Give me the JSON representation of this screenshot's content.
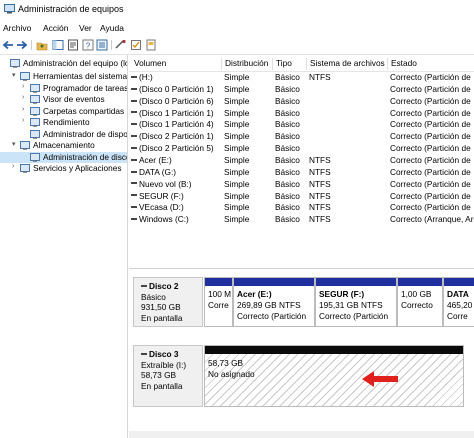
{
  "window": {
    "title": "Administración de equipos"
  },
  "menu": [
    "Archivo",
    "Acción",
    "Ver",
    "Ayuda"
  ],
  "tree": [
    {
      "label": "Administración del equipo (loc",
      "indent": 0,
      "arrow": "",
      "icon": "computer-icon"
    },
    {
      "label": "Herramientas del sistema",
      "indent": 1,
      "arrow": "▾",
      "icon": "tools-icon"
    },
    {
      "label": "Programador de tareas",
      "indent": 2,
      "arrow": "›",
      "icon": "clock-icon"
    },
    {
      "label": "Visor de eventos",
      "indent": 2,
      "arrow": "›",
      "icon": "event-viewer-icon"
    },
    {
      "label": "Carpetas compartidas",
      "indent": 2,
      "arrow": "›",
      "icon": "shared-folder-icon"
    },
    {
      "label": "Rendimiento",
      "indent": 2,
      "arrow": "›",
      "icon": "performance-icon"
    },
    {
      "label": "Administrador de dispo",
      "indent": 2,
      "arrow": "",
      "icon": "device-manager-icon"
    },
    {
      "label": "Almacenamiento",
      "indent": 1,
      "arrow": "▾",
      "icon": "storage-icon"
    },
    {
      "label": "Administración de disco",
      "indent": 2,
      "arrow": "",
      "icon": "disk-icon",
      "selected": true
    },
    {
      "label": "Servicios y Aplicaciones",
      "indent": 1,
      "arrow": "›",
      "icon": "services-icon"
    }
  ],
  "volumes": {
    "columns": [
      "Volumen",
      "Distribución",
      "Tipo",
      "Sistema de archivos",
      "Estado"
    ],
    "rows": [
      [
        "(H:)",
        "Simple",
        "Básico",
        "NTFS",
        "Correcto (Partición de"
      ],
      [
        "(Disco 0 Partición 1)",
        "Simple",
        "Básico",
        "",
        "Correcto (Partición de"
      ],
      [
        "(Disco 0 Partición 6)",
        "Simple",
        "Básico",
        "",
        "Correcto (Partición de"
      ],
      [
        "(Disco 1 Partición 1)",
        "Simple",
        "Básico",
        "",
        "Correcto (Partición de"
      ],
      [
        "(Disco 1 Partición 4)",
        "Simple",
        "Básico",
        "",
        "Correcto (Partición de"
      ],
      [
        "(Disco 2 Partición 1)",
        "Simple",
        "Básico",
        "",
        "Correcto (Partición de"
      ],
      [
        "(Disco 2 Partición 5)",
        "Simple",
        "Básico",
        "",
        "Correcto (Partición de"
      ],
      [
        "Acer (E:)",
        "Simple",
        "Básico",
        "NTFS",
        "Correcto (Partición de"
      ],
      [
        "DATA (G:)",
        "Simple",
        "Básico",
        "NTFS",
        "Correcto (Partición de"
      ],
      [
        "Nuevo vol (B:)",
        "Simple",
        "Básico",
        "NTFS",
        "Correcto (Partición de"
      ],
      [
        "SEGUR (F:)",
        "Simple",
        "Básico",
        "NTFS",
        "Correcto (Partición de"
      ],
      [
        "VEcasa (D:)",
        "Simple",
        "Básico",
        "NTFS",
        "Correcto (Partición de"
      ],
      [
        "Windows (C:)",
        "Simple",
        "Básico",
        "NTFS",
        "Correcto (Arranque, Are"
      ]
    ]
  },
  "disks": {
    "disk2": {
      "name": "Disco 2",
      "type": "Básico",
      "size": "931,50 GB",
      "status": "En pantalla",
      "partitions": [
        {
          "line1": "100 M",
          "line2": "Corre",
          "line3": ""
        },
        {
          "line1": "Acer  (E:)",
          "line2": "269,89 GB NTFS",
          "line3": "Correcto (Partición"
        },
        {
          "line1": "SEGUR  (F:)",
          "line2": "195,31 GB NTFS",
          "line3": "Correcto (Partición"
        },
        {
          "line1": "1,00 GB",
          "line2": "Correcto",
          "line3": ""
        },
        {
          "line1": "DATA",
          "line2": "465,20",
          "line3": "Corre"
        }
      ]
    },
    "disk3": {
      "name": "Disco 3",
      "type": "Extraíble (I:)",
      "size": "58,73 GB",
      "status": "En pantalla",
      "unallocated_size": "58,73 GB",
      "unallocated_label": "No asignado"
    }
  },
  "colors": {
    "partition_blue": "#1f2f9e",
    "unallocated_black": "#0a0a0a",
    "arrow_red": "#e0211c",
    "selection": "#cce4f7"
  }
}
